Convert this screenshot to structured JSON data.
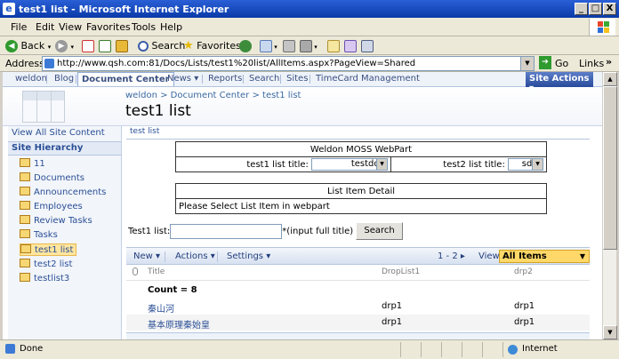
{
  "window": {
    "title": "test1 list - Microsoft Internet Explorer",
    "buttons": [
      "_",
      "□",
      "X"
    ]
  },
  "menu": [
    "File",
    "Edit",
    "View",
    "Favorites",
    "Tools",
    "Help"
  ],
  "toolbar": {
    "back": "Back",
    "search": "Search",
    "favorites": "Favorites"
  },
  "address": {
    "label": "Address",
    "url": "http://www.qsh.com:81/Docs/Lists/test1%20list/AllItems.aspx?PageView=Shared",
    "go": "Go",
    "links": "Links"
  },
  "topnav": {
    "tabs": [
      "weldon",
      "Blog",
      "Document Center",
      "News ▾",
      "Reports",
      "Search",
      "Sites",
      "TimeCard Management"
    ],
    "active": "Document Center",
    "site_actions": "Site Actions ▾"
  },
  "header": {
    "breadcrumb": "weldon > Document Center > test1 list",
    "title": "test1 list"
  },
  "leftnav": {
    "view_all": "View All Site Content",
    "hierarchy": "Site Hierarchy",
    "items": [
      "11",
      "Documents",
      "Announcements",
      "Employees",
      "Review Tasks",
      "Tasks",
      "test1 list",
      "test2 list",
      "testlist3"
    ],
    "selected": "test1 list"
  },
  "webpart": {
    "header": "test list",
    "moss_title": "Weldon MOSS WebPart",
    "list1_label": "test1 list title:",
    "list1_value": "testddd",
    "list2_label": "test2 list title:",
    "list2_value": "sdfa",
    "detail_title": "List Item Detail",
    "detail_text": "Please Select List Item in webpart",
    "search_label": "Test1 list:",
    "search_hint": "*(input full title)",
    "search_button": "Search"
  },
  "listview": {
    "new": "New ▾",
    "actions": "Actions ▾",
    "settings": "Settings ▾",
    "paging": "1 - 2 ▸",
    "view_label": "View:",
    "view_value": "All Items",
    "columns": [
      "Title",
      "DropList1",
      "drp2"
    ],
    "count": "Count = 8",
    "rows": [
      {
        "title": "秦山河",
        "d1": "drp1",
        "d2": "drp1"
      },
      {
        "title": "基本原理秦始皇",
        "d1": "drp1",
        "d2": "drp1"
      }
    ]
  },
  "status": {
    "text": "Done",
    "zone": "Internet"
  }
}
